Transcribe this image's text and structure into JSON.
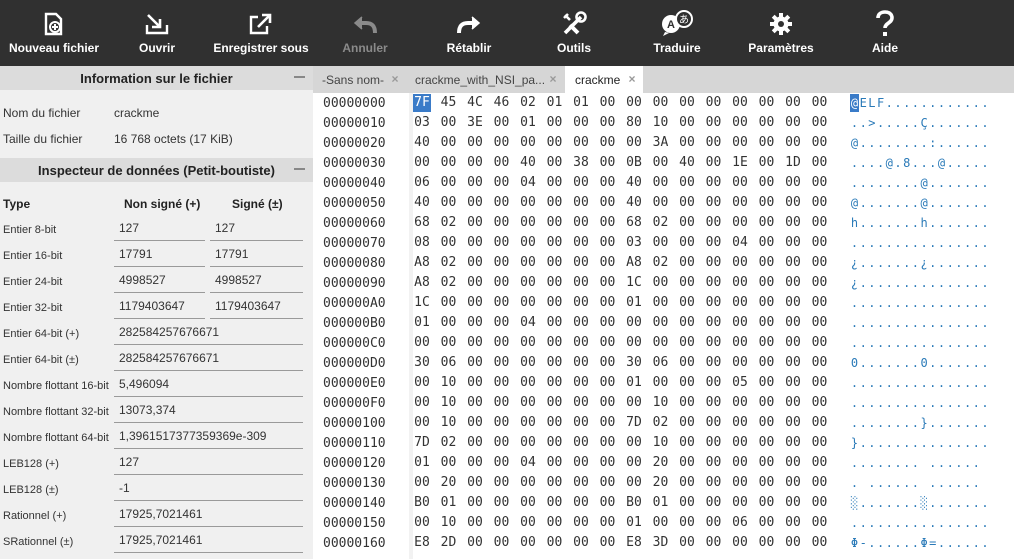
{
  "toolbar": {
    "items": [
      {
        "label": "Nouveau fichier",
        "icon": "new-file-icon",
        "enabled": true
      },
      {
        "label": "Ouvrir",
        "icon": "open-icon",
        "enabled": true
      },
      {
        "label": "Enregistrer sous",
        "icon": "save-as-icon",
        "enabled": true
      },
      {
        "label": "Annuler",
        "icon": "undo-icon",
        "enabled": false
      },
      {
        "label": "Rétablir",
        "icon": "redo-icon",
        "enabled": true
      },
      {
        "label": "Outils",
        "icon": "tools-icon",
        "enabled": true
      },
      {
        "label": "Traduire",
        "icon": "translate-icon",
        "enabled": true
      },
      {
        "label": "Paramètres",
        "icon": "gear-icon",
        "enabled": true
      },
      {
        "label": "Aide",
        "icon": "help-icon",
        "enabled": true
      }
    ]
  },
  "file_info": {
    "title": "Information sur le fichier",
    "name_label": "Nom du fichier",
    "name_value": "crackme",
    "size_label": "Taille du fichier",
    "size_value": "16 768 octets (17 KiB)"
  },
  "inspector": {
    "title": "Inspecteur de données (Petit-boutiste)",
    "col_type": "Type",
    "col_unsigned": "Non signé (+)",
    "col_signed": "Signé (±)",
    "rows": [
      {
        "label": "Entier 8-bit",
        "unsigned": "127",
        "signed": "127"
      },
      {
        "label": "Entier 16-bit",
        "unsigned": "17791",
        "signed": "17791"
      },
      {
        "label": "Entier 24-bit",
        "unsigned": "4998527",
        "signed": "4998527"
      },
      {
        "label": "Entier 32-bit",
        "unsigned": "1179403647",
        "signed": "1179403647"
      },
      {
        "label": "Entier 64-bit (+)",
        "value": "282584257676671"
      },
      {
        "label": "Entier 64-bit (±)",
        "value": "282584257676671"
      },
      {
        "label": "Nombre flottant 16-bit",
        "value": "5,496094"
      },
      {
        "label": "Nombre flottant 32-bit",
        "value": "13073,374"
      },
      {
        "label": "Nombre flottant 64-bit",
        "value": "1,3961517377359369e-309"
      },
      {
        "label": "LEB128 (+)",
        "value": "127"
      },
      {
        "label": "LEB128 (±)",
        "value": "-1"
      },
      {
        "label": "Rationnel (+)",
        "value": "17925,7021461"
      },
      {
        "label": "SRationnel (±)",
        "value": "17925,7021461"
      }
    ]
  },
  "tabs": [
    {
      "label": "-Sans nom-",
      "active": false
    },
    {
      "label": "crackme_with_NSI_pa...",
      "active": false
    },
    {
      "label": "crackme",
      "active": true
    }
  ],
  "hex_view": {
    "rows": [
      {
        "offset": "00000000",
        "bytes": "7F 45 4C 46 02 01 01 00 00 00 00 00 00 00 00 00",
        "ascii": "@ELF............"
      },
      {
        "offset": "00000010",
        "bytes": "03 00 3E 00 01 00 00 00 80 10 00 00 00 00 00 00",
        "ascii": "..>.....Ç......."
      },
      {
        "offset": "00000020",
        "bytes": "40 00 00 00 00 00 00 00 00 3A 00 00 00 00 00 00",
        "ascii": "@........:......"
      },
      {
        "offset": "00000030",
        "bytes": "00 00 00 00 40 00 38 00 0B 00 40 00 1E 00 1D 00",
        "ascii": "....@.8...@....."
      },
      {
        "offset": "00000040",
        "bytes": "06 00 00 00 04 00 00 00 40 00 00 00 00 00 00 00",
        "ascii": "........@......."
      },
      {
        "offset": "00000050",
        "bytes": "40 00 00 00 00 00 00 00 40 00 00 00 00 00 00 00",
        "ascii": "@.......@......."
      },
      {
        "offset": "00000060",
        "bytes": "68 02 00 00 00 00 00 00 68 02 00 00 00 00 00 00",
        "ascii": "h.......h......."
      },
      {
        "offset": "00000070",
        "bytes": "08 00 00 00 00 00 00 00 03 00 00 00 04 00 00 00",
        "ascii": "................"
      },
      {
        "offset": "00000080",
        "bytes": "A8 02 00 00 00 00 00 00 A8 02 00 00 00 00 00 00",
        "ascii": "¿.......¿......."
      },
      {
        "offset": "00000090",
        "bytes": "A8 02 00 00 00 00 00 00 1C 00 00 00 00 00 00 00",
        "ascii": "¿..............."
      },
      {
        "offset": "000000A0",
        "bytes": "1C 00 00 00 00 00 00 00 01 00 00 00 00 00 00 00",
        "ascii": "................"
      },
      {
        "offset": "000000B0",
        "bytes": "01 00 00 00 04 00 00 00 00 00 00 00 00 00 00 00",
        "ascii": "................"
      },
      {
        "offset": "000000C0",
        "bytes": "00 00 00 00 00 00 00 00 00 00 00 00 00 00 00 00",
        "ascii": "................"
      },
      {
        "offset": "000000D0",
        "bytes": "30 06 00 00 00 00 00 00 30 06 00 00 00 00 00 00",
        "ascii": "0.......0......."
      },
      {
        "offset": "000000E0",
        "bytes": "00 10 00 00 00 00 00 00 01 00 00 00 05 00 00 00",
        "ascii": "................"
      },
      {
        "offset": "000000F0",
        "bytes": "00 10 00 00 00 00 00 00 00 10 00 00 00 00 00 00",
        "ascii": "................"
      },
      {
        "offset": "00000100",
        "bytes": "00 10 00 00 00 00 00 00 7D 02 00 00 00 00 00 00",
        "ascii": "........}......."
      },
      {
        "offset": "00000110",
        "bytes": "7D 02 00 00 00 00 00 00 00 10 00 00 00 00 00 00",
        "ascii": "}..............."
      },
      {
        "offset": "00000120",
        "bytes": "01 00 00 00 04 00 00 00 00 20 00 00 00 00 00 00",
        "ascii": "........ ......"
      },
      {
        "offset": "00000130",
        "bytes": "00 20 00 00 00 00 00 00 00 20 00 00 00 00 00 00",
        "ascii": ". ...... ......"
      },
      {
        "offset": "00000140",
        "bytes": "B0 01 00 00 00 00 00 00 B0 01 00 00 00 00 00 00",
        "ascii": "░.......░......."
      },
      {
        "offset": "00000150",
        "bytes": "00 10 00 00 00 00 00 00 01 00 00 00 06 00 00 00",
        "ascii": "................"
      },
      {
        "offset": "00000160",
        "bytes": "E8 2D 00 00 00 00 00 00 E8 3D 00 00 00 00 00 00",
        "ascii": "Φ-......Φ=......"
      }
    ]
  }
}
